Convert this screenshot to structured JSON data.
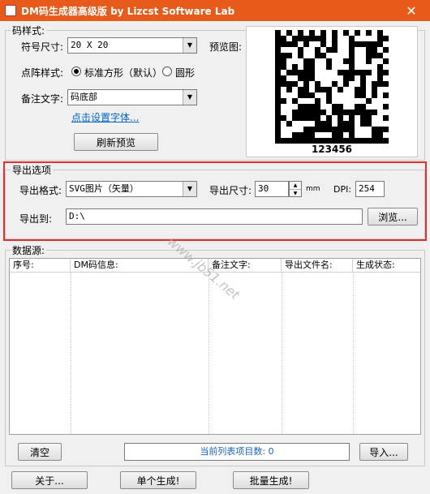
{
  "window": {
    "title": "DM码生成器高级版  by Lizcst Software Lab",
    "close_glyph": "✕"
  },
  "code_style": {
    "legend": "码样式:",
    "symbol_size": {
      "label": "符号尺寸:",
      "value": "20 X 20"
    },
    "dot_style": {
      "label": "点阵样式:",
      "options": [
        {
          "label": "标准方形（默认）",
          "checked": true
        },
        {
          "label": "圆形",
          "checked": false
        }
      ]
    },
    "note_text": {
      "label": "备注文字:",
      "value": "码底部"
    },
    "font_link": "点击设置字体...",
    "refresh_button": "刷新预览",
    "preview": {
      "label": "预览图:",
      "caption": "123456"
    }
  },
  "export": {
    "legend": "导出选项",
    "format": {
      "label": "导出格式:",
      "value": "SVG图片（矢量）"
    },
    "size": {
      "label": "导出尺寸:",
      "value": "30",
      "unit": "mm"
    },
    "dpi": {
      "label": "DPI:",
      "value": "254"
    },
    "path": {
      "label": "导出到:",
      "value": "D:\\"
    },
    "browse_button": "浏览..."
  },
  "data_source": {
    "legend": "数据源:",
    "columns": [
      "序号:",
      "DM码信息:",
      "备注文字:",
      "导出文件名:",
      "生成状态:"
    ],
    "clear_button": "清空",
    "status": "当前列表项目数: 0",
    "import_button": "导入..."
  },
  "footer": {
    "about_button": "关于...",
    "single_button": "单个生成!",
    "batch_button": "批量生成!"
  },
  "watermark": "www.jb51.net",
  "colors": {
    "titlebar": "#e85a1a",
    "highlight": "#e03030",
    "link": "#0066cc",
    "status_text": "#1a63c9"
  }
}
